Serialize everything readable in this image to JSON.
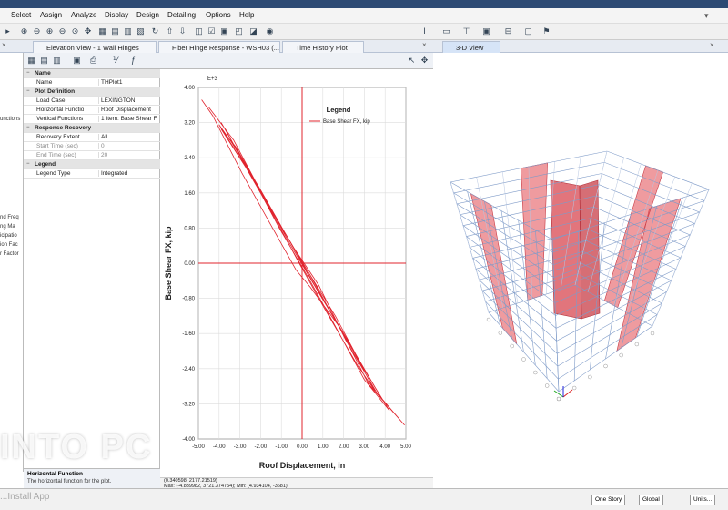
{
  "menu": [
    "Select",
    "Assign",
    "Analyze",
    "Display",
    "Design",
    "Detailing",
    "Options",
    "Help"
  ],
  "tabs": [
    {
      "label": "Elevation View - 1  Wall Hinges"
    },
    {
      "label": "Fiber Hinge Response - WSH03 (..."
    },
    {
      "label": "Time History Plot"
    },
    {
      "label": "3-D View"
    }
  ],
  "left_strip": [
    "unctions",
    "nd Freq",
    "ng Ma",
    "icipatio",
    "ion Fac",
    "r Factor"
  ],
  "properties": [
    {
      "type": "cat",
      "key": "Name"
    },
    {
      "type": "row",
      "key": "Name",
      "value": "THPlot1"
    },
    {
      "type": "cat",
      "key": "Plot Definition"
    },
    {
      "type": "row",
      "key": "Load Case",
      "value": "LEXINGTON"
    },
    {
      "type": "row",
      "key": "Horizontal Function",
      "value": "Roof Displacement"
    },
    {
      "type": "row",
      "key": "Vertical Functions",
      "value": "1 Item: Base Shear F"
    },
    {
      "type": "cat",
      "key": "Response Recovery"
    },
    {
      "type": "row",
      "key": "Recovery Extent",
      "value": "All"
    },
    {
      "type": "dim",
      "key": "Start Time (sec)",
      "value": "0"
    },
    {
      "type": "dim",
      "key": "End Time (sec)",
      "value": "20"
    },
    {
      "type": "cat",
      "key": "Legend"
    },
    {
      "type": "row",
      "key": "Legend Type",
      "value": "Integrated"
    }
  ],
  "description": {
    "title": "Horizontal Function",
    "text": "The horizontal function for the plot."
  },
  "plot_status": {
    "line1": "(0.340598, 2177.21519)",
    "line2": "Max: (-4.839982, 3721.374754);  Min: (4.934104, -3681)"
  },
  "chart_data": {
    "type": "line",
    "multiplier_label": "E+3",
    "xlabel": "Roof Displacement,  in",
    "ylabel": "Base Shear FX,  kip",
    "xlim": [
      -5,
      5
    ],
    "ylim": [
      -4,
      4
    ],
    "xticks": [
      "-5.00",
      "-4.00",
      "-3.00",
      "-2.00",
      "-1.00",
      "0.00",
      "1.00",
      "2.00",
      "3.00",
      "4.00",
      "5.00"
    ],
    "yticks": [
      "4.00",
      "3.20",
      "2.40",
      "1.60",
      "0.80",
      "0.00",
      "-0.80",
      "-1.60",
      "-2.40",
      "-3.20",
      "-4.00"
    ],
    "grid": true,
    "legend_title": "Legend",
    "legend_position": "top-right",
    "series": [
      {
        "name": "Base Shear FX,  kip",
        "color": "#e0242e",
        "x": [
          -4.84,
          -4.3,
          -3.6,
          -2.9,
          -1.6,
          -0.3,
          0.4,
          1.8,
          3.2,
          4.93,
          3.6,
          2.1,
          0.8,
          -0.4,
          -1.9,
          -3.3,
          -4.5,
          -3.7,
          -2.6,
          -1.3,
          0.1,
          1.6,
          2.9,
          4.2,
          3.0,
          1.5,
          0.2,
          -1.1,
          -2.4,
          -3.9,
          -3.2,
          -1.7,
          -0.6,
          0.9,
          2.3,
          3.5,
          2.7,
          1.1,
          -0.2,
          -1.4,
          -2.8,
          -4.0,
          -3.4,
          -2.1,
          -0.9,
          0.6,
          2.0,
          3.8,
          1.9,
          0.3,
          -1.6,
          -3.0,
          -3.9
        ],
        "y": [
          3.72,
          3.35,
          2.7,
          2.05,
          0.95,
          -0.15,
          -0.55,
          -1.45,
          -2.75,
          -3.68,
          -2.95,
          -1.75,
          -0.5,
          0.35,
          1.55,
          2.8,
          3.55,
          3.05,
          2.1,
          1.05,
          -0.05,
          -1.2,
          -2.35,
          -3.35,
          -2.65,
          -1.35,
          -0.25,
          0.8,
          1.95,
          3.05,
          2.65,
          1.4,
          0.45,
          -0.75,
          -1.85,
          -2.9,
          -2.35,
          -1.05,
          0.05,
          1.1,
          2.25,
          3.15,
          2.75,
          1.75,
          0.75,
          -0.5,
          -1.6,
          -3.05,
          -1.55,
          -0.2,
          1.3,
          2.45,
          3.2
        ]
      }
    ]
  },
  "statusbar": {
    "units_mode": "One Story",
    "coord_system": "Global",
    "units": "Units..."
  },
  "watermark": {
    "text": "INTO PC",
    "sub": "...Install App"
  }
}
